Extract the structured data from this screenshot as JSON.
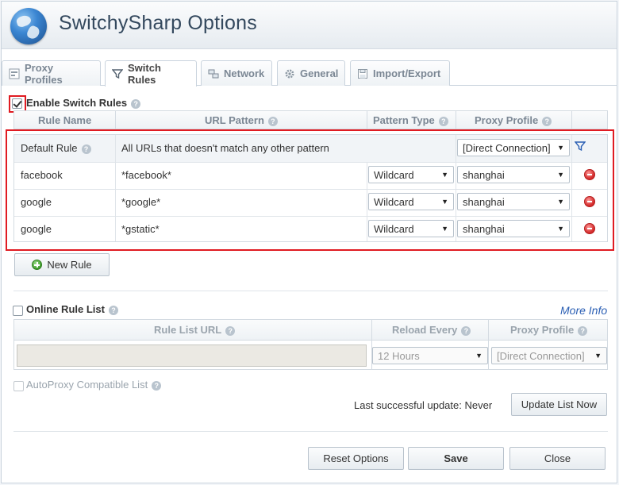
{
  "app": {
    "title": "SwitchySharp Options"
  },
  "tabs": [
    {
      "label": "Proxy Profiles",
      "icon": "proxy-profiles-icon",
      "active": false
    },
    {
      "label": "Switch Rules",
      "icon": "filter-icon",
      "active": true
    },
    {
      "label": "Network",
      "icon": "network-icon",
      "active": false
    },
    {
      "label": "General",
      "icon": "gear-icon",
      "active": false
    },
    {
      "label": "Import/Export",
      "icon": "import-export-icon",
      "active": false
    }
  ],
  "switch_rules": {
    "enable_label": "Enable Switch Rules",
    "enabled": true,
    "columns": [
      "Rule Name",
      "URL Pattern",
      "Pattern Type",
      "Proxy Profile"
    ],
    "rows": [
      {
        "name": "Default Rule",
        "pattern": "All URLs that doesn't match any other pattern",
        "type": "",
        "profile": "[Direct Connection]"
      },
      {
        "name": "facebook",
        "pattern": "*facebook*",
        "type": "Wildcard",
        "profile": "shanghai"
      },
      {
        "name": "google",
        "pattern": "*google*",
        "type": "Wildcard",
        "profile": "shanghai"
      },
      {
        "name": "google",
        "pattern": "*gstatic*",
        "type": "Wildcard",
        "profile": "shanghai"
      }
    ],
    "new_rule_label": "New Rule"
  },
  "online_rule_list": {
    "label": "Online Rule List",
    "enabled": false,
    "more_info": "More Info",
    "columns": [
      "Rule List URL",
      "Reload Every",
      "Proxy Profile"
    ],
    "url_value": "",
    "reload_every": "12 Hours",
    "proxy_profile": "[Direct Connection]",
    "autoproxy_label": "AutoProxy Compatible List",
    "last_update": "Last successful update: Never",
    "update_button": "Update List Now"
  },
  "footer": {
    "reset_label": "Reset Options",
    "save_label": "Save",
    "close_label": "Close"
  },
  "colors": {
    "highlight": "#e01b22",
    "link": "#2b5fb4"
  }
}
